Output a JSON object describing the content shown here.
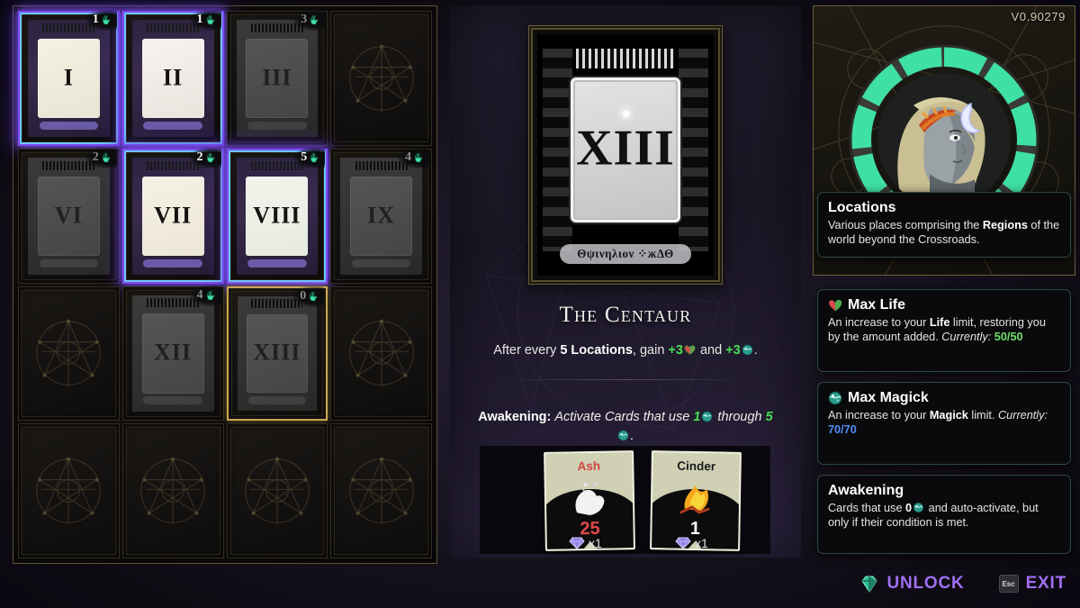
{
  "version": "V0.90279",
  "grid": {
    "cells": [
      {
        "roman": "I",
        "cost": "1",
        "state": "unlocked",
        "holo": "holo-1"
      },
      {
        "roman": "II",
        "cost": "1",
        "state": "unlocked",
        "holo": "holo-2"
      },
      {
        "roman": "III",
        "cost": "3",
        "state": "locked",
        "holo": ""
      },
      {
        "roman": "",
        "cost": "",
        "state": "empty",
        "holo": ""
      },
      {
        "roman": "VI",
        "cost": "2",
        "state": "locked",
        "holo": ""
      },
      {
        "roman": "VII",
        "cost": "2",
        "state": "unlocked",
        "holo": "holo-3"
      },
      {
        "roman": "VIII",
        "cost": "5",
        "state": "unlocked",
        "holo": "holo-4"
      },
      {
        "roman": "IX",
        "cost": "4",
        "state": "locked",
        "holo": ""
      },
      {
        "roman": "",
        "cost": "",
        "state": "empty",
        "holo": ""
      },
      {
        "roman": "XII",
        "cost": "4",
        "state": "locked",
        "holo": ""
      },
      {
        "roman": "XIII",
        "cost": "0",
        "state": "selected",
        "holo": ""
      },
      {
        "roman": "",
        "cost": "",
        "state": "empty",
        "holo": ""
      },
      {
        "roman": "",
        "cost": "",
        "state": "empty",
        "holo": ""
      },
      {
        "roman": "",
        "cost": "",
        "state": "empty",
        "holo": ""
      },
      {
        "roman": "",
        "cost": "",
        "state": "empty",
        "holo": ""
      },
      {
        "roman": "",
        "cost": "",
        "state": "empty",
        "holo": ""
      }
    ]
  },
  "detail": {
    "card_roman": "XIII",
    "card_glyphs": "Θψινηλιον ⁘жΔΘ",
    "title": "The Centaur",
    "description_prefix": "After every ",
    "description_bold": "5 Locations",
    "description_mid": ", gain ",
    "gain_1": "+3",
    "description_and": " and ",
    "gain_2": "+3",
    "description_end": ".",
    "awakening_label": "Awakening",
    "awakening_sep": ": ",
    "awakening_text_1": "Activate Cards that use ",
    "awakening_val_1": "1",
    "awakening_text_2": " through ",
    "awakening_val_2": "5",
    "awakening_text_3": "."
  },
  "costs": {
    "items": [
      {
        "name": "Ash",
        "amount": "25",
        "gem_mult": "x1"
      },
      {
        "name": "Cinder",
        "amount": "1",
        "gem_mult": "x1"
      }
    ]
  },
  "right": {
    "progress": "9",
    "progress_slash": "/",
    "progress_total": "10",
    "tooltips": [
      {
        "id": "locations",
        "title": "Locations",
        "icon": "none",
        "body_1": "Various places comprising the ",
        "body_bold": "Regions",
        "body_2": " of the world beyond the Crossroads."
      },
      {
        "id": "max-life",
        "title": "Max Life",
        "icon": "heart-icon",
        "body_1": "An increase to your ",
        "body_bold": "Life",
        "body_2": " limit, restoring you by the amount added. ",
        "body_italic": "Currently: ",
        "value_a": "50",
        "value_sep": "/",
        "value_b": "50"
      },
      {
        "id": "max-magick",
        "title": "Max Magick",
        "icon": "magick-icon",
        "body_1": "An increase to your ",
        "body_bold": "Magick",
        "body_2": " limit. ",
        "body_italic": "Currently: ",
        "value_a": "70",
        "value_sep": "/",
        "value_b": "70"
      },
      {
        "id": "awakening",
        "title": "Awakening",
        "icon": "none",
        "body_1": "Cards that use ",
        "body_value": "0",
        "body_2": " and auto-activate, but only if their condition is met."
      }
    ],
    "actions": {
      "unlock_label": "UNLOCK",
      "unlock_icon": "gem-icon",
      "exit_label": "EXIT",
      "exit_key": "Esc"
    }
  },
  "colors": {
    "accent_purple": "#a06ff0",
    "life_green": "#6ee06a",
    "magick_blue": "#4f8ef7",
    "value_green": "#4ade52",
    "ring_teal": "#3fe0a5",
    "gold_border": "#c9a84c"
  }
}
